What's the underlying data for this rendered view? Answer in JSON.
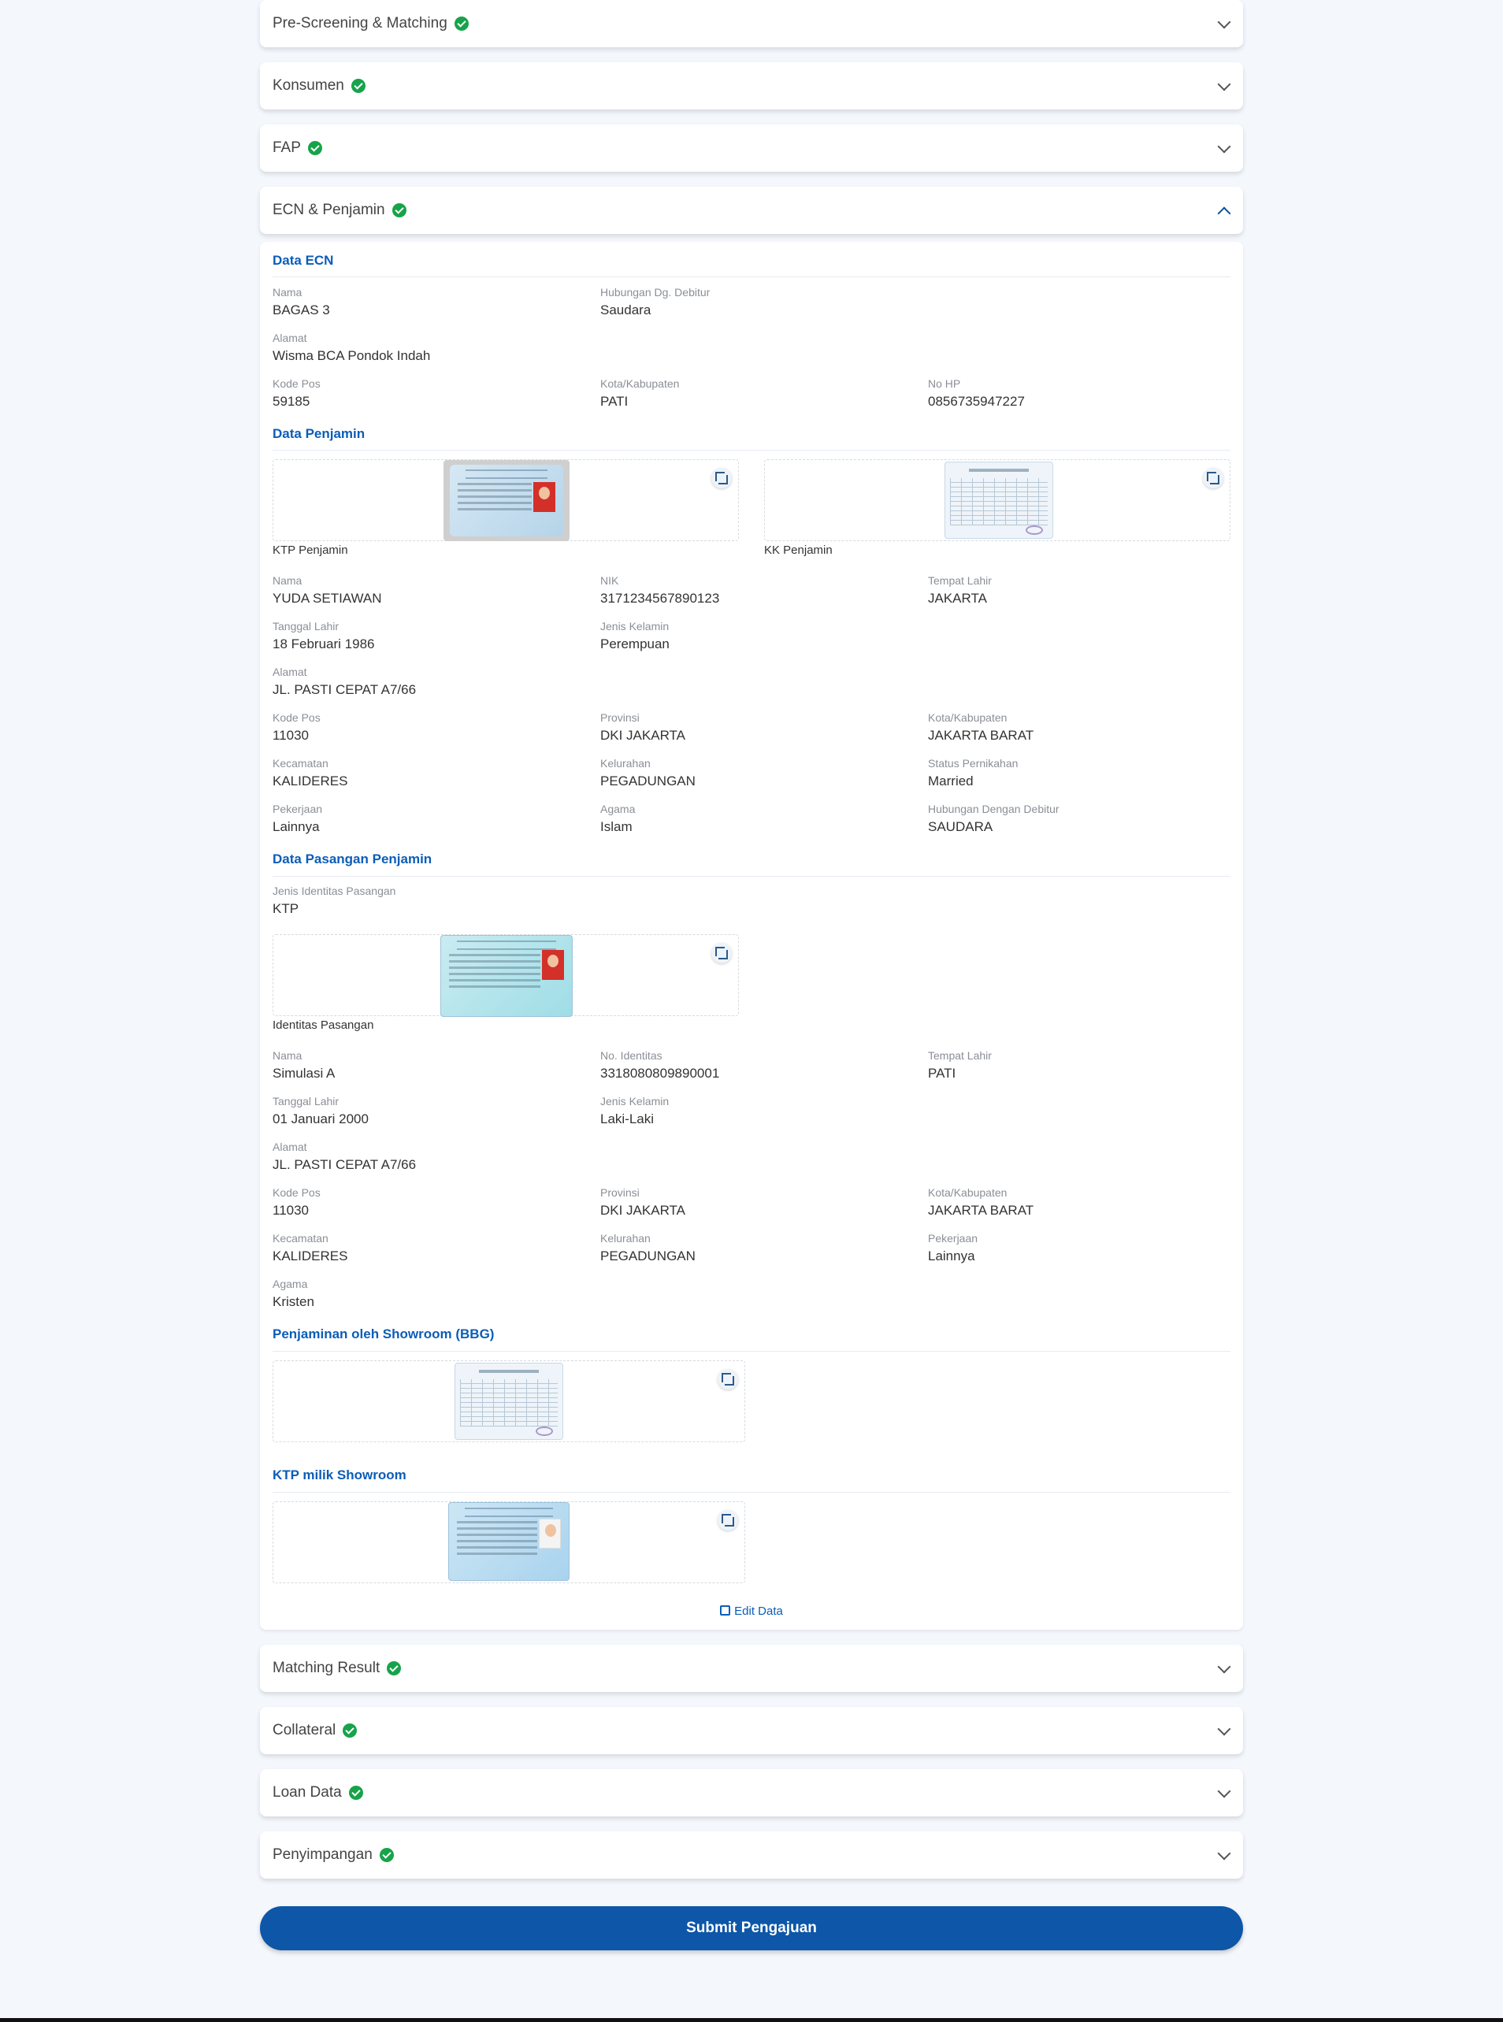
{
  "accordions_top": [
    {
      "title": "Pre-Screening & Matching"
    },
    {
      "title": "Konsumen"
    },
    {
      "title": "FAP"
    },
    {
      "title": "ECN & Penjamin"
    }
  ],
  "accordions_bottom": [
    {
      "title": "Matching Result"
    },
    {
      "title": "Collateral"
    },
    {
      "title": "Loan Data"
    },
    {
      "title": "Penyimpangan"
    }
  ],
  "ecn": {
    "section_title": "Data ECN",
    "nama": {
      "label": "Nama",
      "value": "BAGAS 3"
    },
    "hubungan": {
      "label": "Hubungan Dg. Debitur",
      "value": "Saudara"
    },
    "alamat": {
      "label": "Alamat",
      "value": "Wisma BCA Pondok Indah"
    },
    "kode_pos": {
      "label": "Kode Pos",
      "value": "59185"
    },
    "kota": {
      "label": "Kota/Kabupaten",
      "value": "PATI"
    },
    "no_hp": {
      "label": "No HP",
      "value": "0856735947227"
    }
  },
  "penjamin": {
    "section_title": "Data Penjamin",
    "ktp_caption": "KTP Penjamin",
    "kk_caption": "KK Penjamin",
    "nama": {
      "label": "Nama",
      "value": "YUDA SETIAWAN"
    },
    "nik": {
      "label": "NIK",
      "value": "3171234567890123"
    },
    "tempat_lahir": {
      "label": "Tempat Lahir",
      "value": "JAKARTA"
    },
    "tanggal_lahir": {
      "label": "Tanggal Lahir",
      "value": "18 Februari 1986"
    },
    "jenis_kelamin": {
      "label": "Jenis Kelamin",
      "value": "Perempuan"
    },
    "alamat": {
      "label": "Alamat",
      "value": "JL. PASTI CEPAT A7/66"
    },
    "kode_pos": {
      "label": "Kode Pos",
      "value": "11030"
    },
    "provinsi": {
      "label": "Provinsi",
      "value": "DKI JAKARTA"
    },
    "kota": {
      "label": "Kota/Kabupaten",
      "value": "JAKARTA BARAT"
    },
    "kecamatan": {
      "label": "Kecamatan",
      "value": "KALIDERES"
    },
    "kelurahan": {
      "label": "Kelurahan",
      "value": "PEGADUNGAN"
    },
    "status_pernikahan": {
      "label": "Status Pernikahan",
      "value": "Married"
    },
    "pekerjaan": {
      "label": "Pekerjaan",
      "value": "Lainnya"
    },
    "agama": {
      "label": "Agama",
      "value": "Islam"
    },
    "hubungan": {
      "label": "Hubungan Dengan Debitur",
      "value": "SAUDARA"
    }
  },
  "pasangan": {
    "section_title": "Data Pasangan Penjamin",
    "jenis_identitas": {
      "label": "Jenis Identitas Pasangan",
      "value": "KTP"
    },
    "identitas_caption": "Identitas Pasangan",
    "nama": {
      "label": "Nama",
      "value": "Simulasi A"
    },
    "no_identitas": {
      "label": "No. Identitas",
      "value": "3318080809890001"
    },
    "tempat_lahir": {
      "label": "Tempat Lahir",
      "value": "PATI"
    },
    "tanggal_lahir": {
      "label": "Tanggal Lahir",
      "value": "01 Januari 2000"
    },
    "jenis_kelamin": {
      "label": "Jenis Kelamin",
      "value": "Laki-Laki"
    },
    "alamat": {
      "label": "Alamat",
      "value": "JL. PASTI CEPAT A7/66"
    },
    "kode_pos": {
      "label": "Kode Pos",
      "value": "11030"
    },
    "provinsi": {
      "label": "Provinsi",
      "value": "DKI JAKARTA"
    },
    "kota": {
      "label": "Kota/Kabupaten",
      "value": "JAKARTA BARAT"
    },
    "kecamatan": {
      "label": "Kecamatan",
      "value": "KALIDERES"
    },
    "kelurahan": {
      "label": "Kelurahan",
      "value": "PEGADUNGAN"
    },
    "pekerjaan": {
      "label": "Pekerjaan",
      "value": "Lainnya"
    },
    "agama": {
      "label": "Agama",
      "value": "Kristen"
    }
  },
  "showroom": {
    "penjaminan_title": "Penjaminan oleh Showroom (BBG)",
    "ktp_title": "KTP milik Showroom"
  },
  "edit_label": "Edit Data",
  "submit_label": "Submit Pengajuan",
  "colors": {
    "accent": "#0d56a8",
    "check": "#17a34a",
    "background": "#f4f8fd"
  }
}
